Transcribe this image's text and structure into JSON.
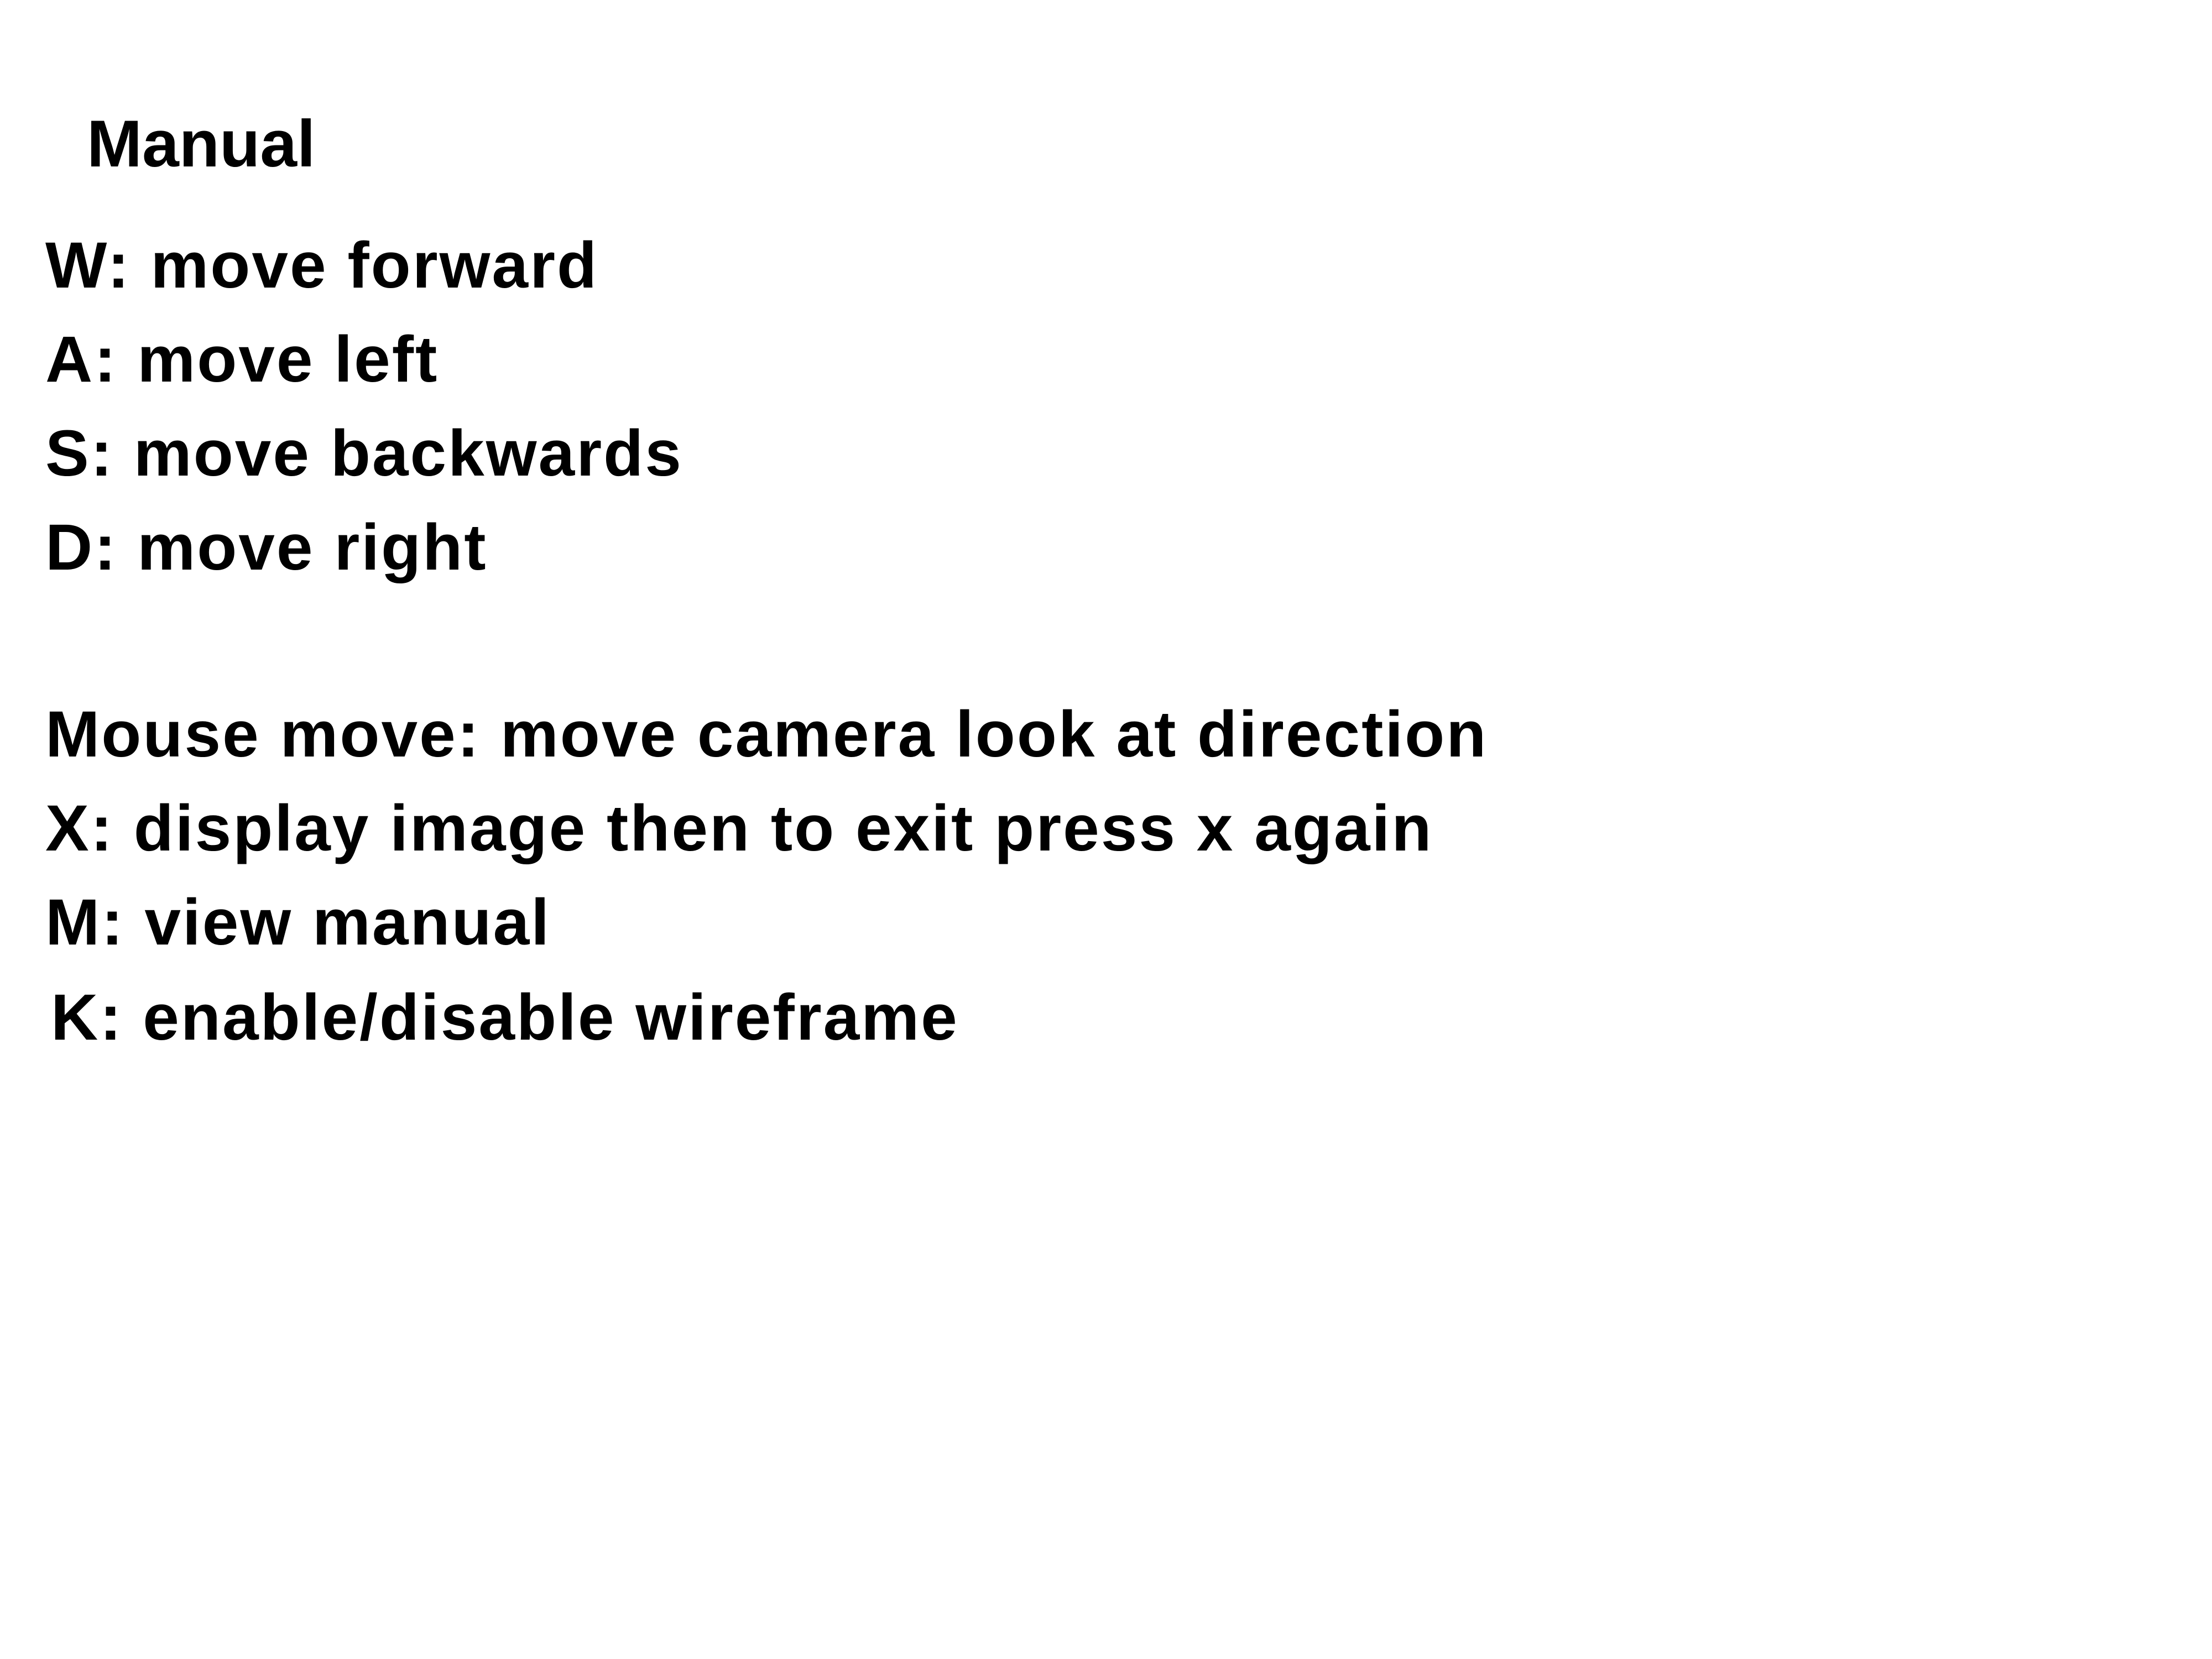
{
  "manual": {
    "title": "Manual",
    "movement_controls": [
      "W: move forward",
      "A: move left",
      "S: move backwards",
      "D: move right"
    ],
    "other_controls": [
      "Mouse move: move camera look at direction",
      "X: display image then to exit press x again",
      "M: view manual",
      "K: enable/disable wireframe"
    ]
  },
  "colors": {
    "background": "#ffffff",
    "text": "#000000"
  }
}
